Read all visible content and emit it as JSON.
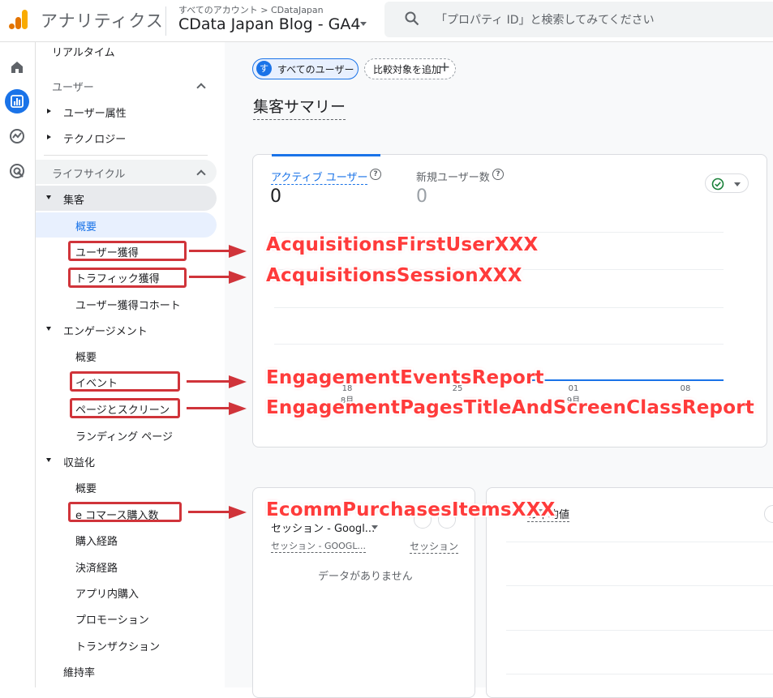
{
  "header": {
    "app_title": "アナリティクス",
    "breadcrumb": "すべてのアカウント > CDataJapan",
    "property_name": "CData Japan Blog - GA4",
    "search_placeholder": "「プロパティ ID」と検索してみてください"
  },
  "rail": {
    "items": [
      {
        "icon": "home-icon"
      },
      {
        "icon": "reports-icon",
        "active": true
      },
      {
        "icon": "explore-icon"
      },
      {
        "icon": "advertising-icon"
      }
    ]
  },
  "sidebar": {
    "realtime": "リアルタイム",
    "user_section": "ユーザー",
    "user_attributes": "ユーザー属性",
    "technology": "テクノロジー",
    "lifecycle_section": "ライフサイクル",
    "acquisition": "集客",
    "acquisition_overview": "概要",
    "user_acquisition": "ユーザー獲得",
    "traffic_acquisition": "トラフィック獲得",
    "user_acquisition_cohort": "ユーザー獲得コホート",
    "engagement": "エンゲージメント",
    "engagement_overview": "概要",
    "events": "イベント",
    "pages_screens": "ページとスクリーン",
    "landing_page": "ランディング ページ",
    "monetization": "収益化",
    "monetization_overview": "概要",
    "ecommerce_purchases": "e コマース購入数",
    "purchase_journey": "購入経路",
    "checkout_journey": "決済経路",
    "in_app_purchases": "アプリ内購入",
    "promotions": "プロモーション",
    "transactions": "トランザクション",
    "retention": "維持率"
  },
  "annotations": {
    "user_acquisition": "AcquisitionsFirstUserXXX",
    "traffic_acquisition": "AcquisitionsSessionXXX",
    "events": "EngagementEventsReport",
    "pages_screens": "EngagementPagesTitleAndScreenClassReport",
    "ecommerce_purchases": "EcommPurchasesItemsXXX"
  },
  "main": {
    "segment_chip": "すべてのユーザー",
    "segment_badge": "す",
    "compare_chip": "比較対象を追加",
    "page_title": "集客サマリー",
    "metric1_label": "アクティブ ユーザー",
    "metric1_value": "0",
    "metric2_label": "新規ユーザー数",
    "metric2_value": "0",
    "x_ticks": [
      {
        "day": "18",
        "month": "8月"
      },
      {
        "day": "25",
        "month": ""
      },
      {
        "day": "01",
        "month": "9月"
      },
      {
        "day": "08",
        "month": ""
      }
    ],
    "card2_dimension": "セッション - Googl...",
    "card2_col1": "セッション - GOOGL...",
    "card2_col2": "セッション",
    "card2_empty": "データがありません",
    "card3_title": "の平均値"
  },
  "colors": {
    "accent": "#1a73e8",
    "annotation": "#d0343a",
    "logo_orange": "#f9ab00",
    "logo_dark": "#e37400"
  }
}
